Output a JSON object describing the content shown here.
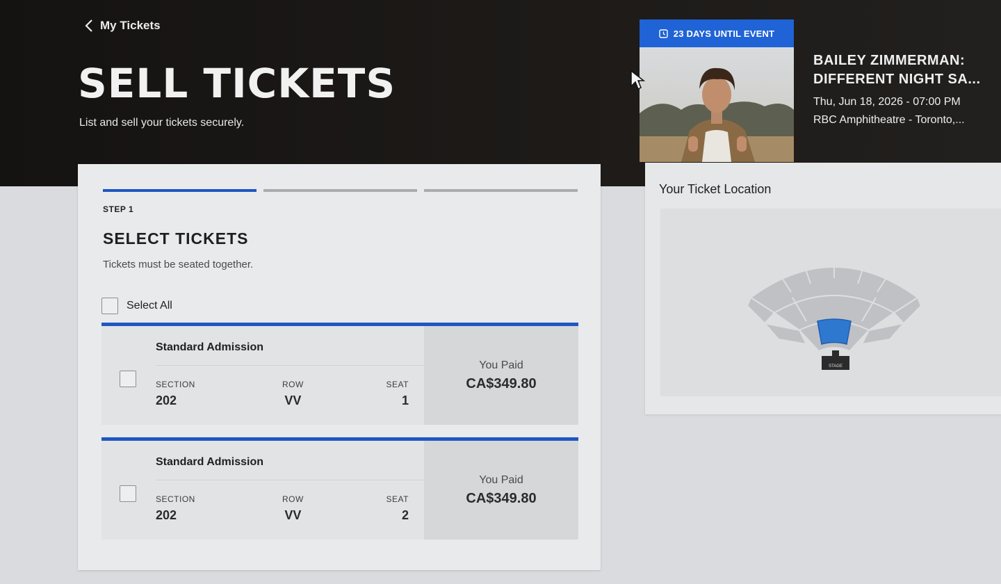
{
  "nav": {
    "back_label": "My Tickets"
  },
  "header": {
    "title": "SELL TICKETS",
    "subtitle": "List and sell your tickets securely."
  },
  "event": {
    "countdown": "23 DAYS UNTIL EVENT",
    "name_line1": "BAILEY ZIMMERMAN:",
    "name_line2": "DIFFERENT NIGHT SA...",
    "date": "Thu, Jun 18, 2026 - 07:00 PM",
    "venue": "RBC Amphitheatre - Toronto,..."
  },
  "sell_form": {
    "step_label": "STEP 1",
    "steps_total": 3,
    "current_step": 1,
    "section_title": "SELECT TICKETS",
    "note": "Tickets must be seated together.",
    "select_all_label": "Select All",
    "field_labels": {
      "section": "SECTION",
      "row": "ROW",
      "seat": "SEAT",
      "paid": "You Paid"
    },
    "tickets": [
      {
        "type": "Standard Admission",
        "section": "202",
        "row": "VV",
        "seat": "1",
        "paid": "CA$349.80",
        "checked": false
      },
      {
        "type": "Standard Admission",
        "section": "202",
        "row": "VV",
        "seat": "2",
        "paid": "CA$349.80",
        "checked": false
      }
    ]
  },
  "location": {
    "title": "Your Ticket Location",
    "stage_label": "STAGE",
    "highlight_color": "#2f78d0"
  },
  "colors": {
    "accent": "#1f56c2",
    "hero_bg": "#1b1917"
  },
  "icons": [
    "chevron-left-icon",
    "clock-icon",
    "cursor-icon"
  ]
}
